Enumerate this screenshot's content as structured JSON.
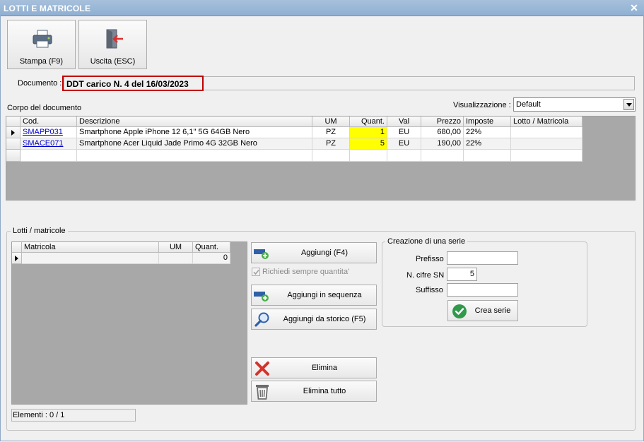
{
  "window": {
    "title": "LOTTI E MATRICOLE",
    "close_glyph": "✕"
  },
  "toolbar": {
    "print_label": "Stampa (F9)",
    "exit_label": "Uscita (ESC)"
  },
  "documento": {
    "label": "Documento :",
    "value": "DDT carico N. 4 del 16/03/2023"
  },
  "corpo": {
    "label": "Corpo del documento",
    "visualizzazione_label": "Visualizzazione :",
    "visualizzazione_value": "Default",
    "columns": [
      "Cod.",
      "Descrizione",
      "UM",
      "Quant.",
      "Val",
      "Prezzo",
      "Imposte",
      "Lotto / Matricola"
    ],
    "rows": [
      {
        "cod": "SMAPP031",
        "descrizione": "Smartphone Apple iPhone 12 6,1\" 5G 64GB Nero",
        "um": "PZ",
        "quant": "1",
        "val": "EU",
        "prezzo": "680,00",
        "imposte": "22%",
        "lotto": ""
      },
      {
        "cod": "SMACE071",
        "descrizione": "Smartphone Acer Liquid Jade Primo 4G 32GB Nero",
        "um": "PZ",
        "quant": "5",
        "val": "EU",
        "prezzo": "190,00",
        "imposte": "22%",
        "lotto": ""
      }
    ]
  },
  "lotti": {
    "group_title": "Lotti / matricole",
    "columns": [
      "Matricola",
      "UM",
      "Quant."
    ],
    "row": {
      "matricola": "",
      "um": "",
      "quant": "0"
    },
    "elementi": "Elementi : 0 / 1"
  },
  "actions": {
    "aggiungi": "Aggiungi (F4)",
    "richiedi": "Richiedi sempre quantita'",
    "aggiungi_sequenza": "Aggiungi in sequenza",
    "aggiungi_storico": "Aggiungi da storico (F5)",
    "elimina": "Elimina",
    "elimina_tutto": "Elimina tutto"
  },
  "serie": {
    "title": "Creazione di una serie",
    "prefisso_label": "Prefisso",
    "prefisso_value": "",
    "cifre_label": "N. cifre SN",
    "cifre_value": "5",
    "suffisso_label": "Suffisso",
    "suffisso_value": "",
    "crea_label": "Crea serie"
  },
  "icons": {
    "print": "printer-icon",
    "exit": "exit-door-icon",
    "add": "add-row-icon",
    "search": "magnifier-icon",
    "delete": "red-x-icon",
    "trash": "trash-icon",
    "check": "green-check-icon"
  }
}
